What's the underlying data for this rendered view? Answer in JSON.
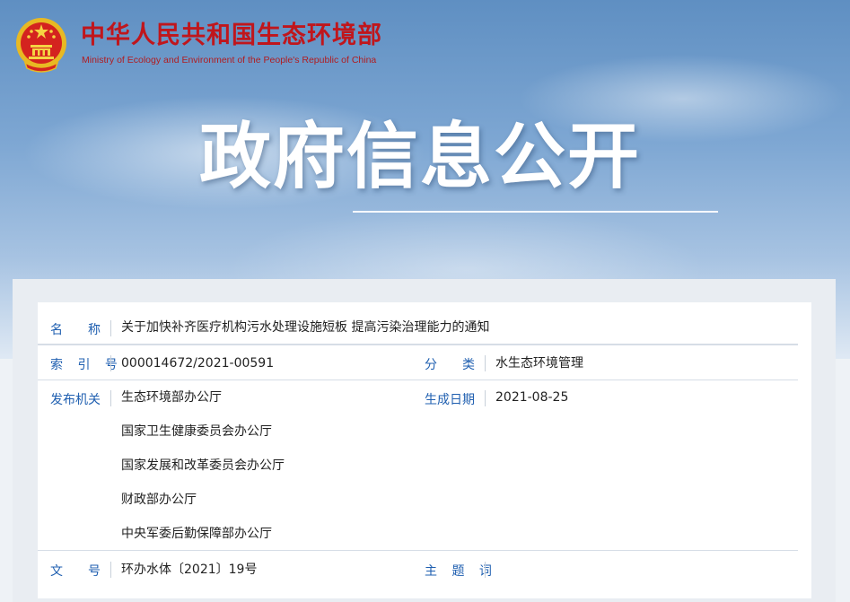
{
  "header": {
    "site_name_cn": "中华人民共和国生态环境部",
    "site_name_en": "Ministry of Ecology and Environment of the People's Republic of China",
    "banner_title": "政府信息公开"
  },
  "colors": {
    "brand_red": "#c0161c",
    "label_blue": "#1f5fb0",
    "emblem_gold": "#e8b923"
  },
  "document": {
    "name_label": "名　　称",
    "name_value": "关于加快补齐医疗机构污水处理设施短板 提高污染治理能力的通知",
    "index_label": "索 引 号",
    "index_value": "000014672/2021-00591",
    "category_label": "分　　类",
    "category_value": "水生态环境管理",
    "issuer_label": "发布机关",
    "issuers": [
      "生态环境部办公厅",
      "国家卫生健康委员会办公厅",
      "国家发展和改革委员会办公厅",
      "财政部办公厅",
      "中央军委后勤保障部办公厅"
    ],
    "date_label": "生成日期",
    "date_value": "2021-08-25",
    "doc_no_label": "文　　号",
    "doc_no_value": "环办水体〔2021〕19号",
    "keywords_label": "主 题 词",
    "keywords_value": ""
  }
}
